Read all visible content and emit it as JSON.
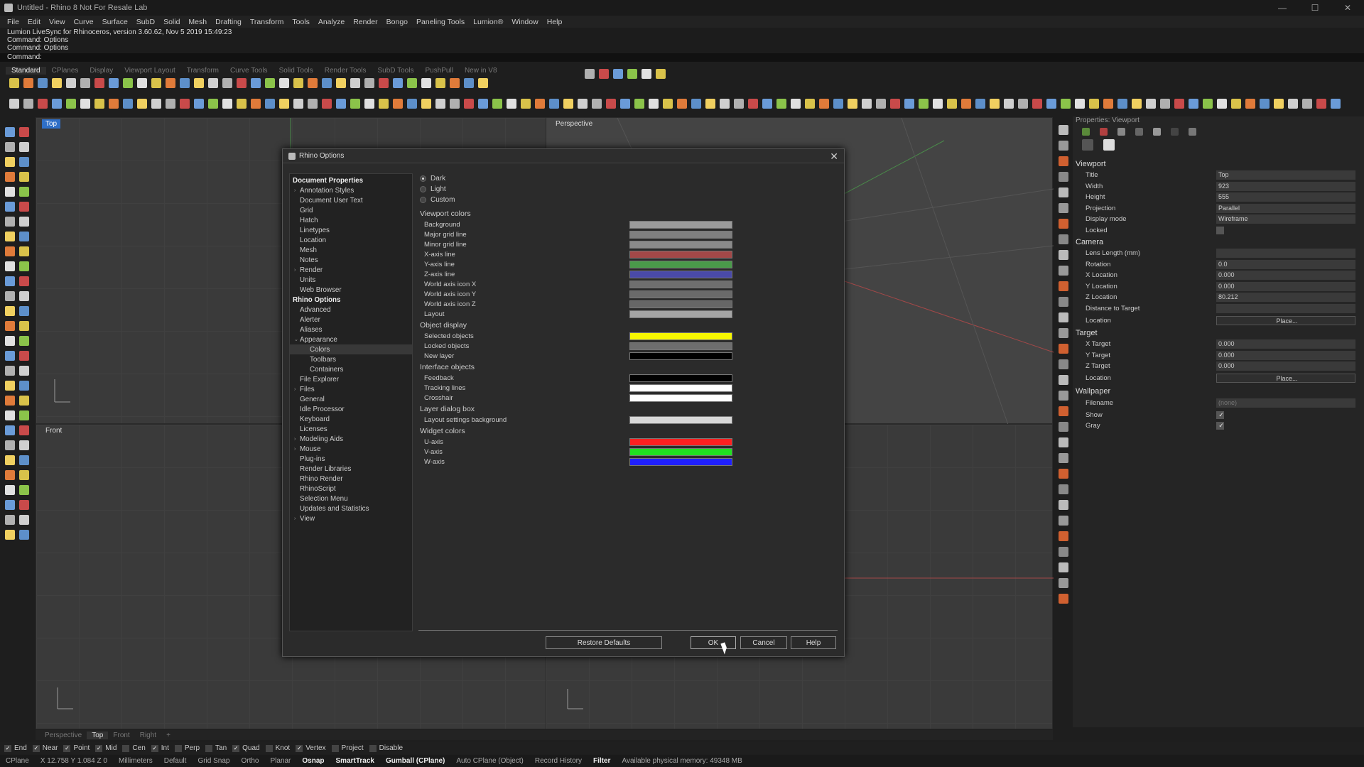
{
  "window": {
    "title": "Untitled - Rhino 8 Not For Resale Lab",
    "minimize": "—",
    "maximize": "☐",
    "close": "✕"
  },
  "menu": [
    "File",
    "Edit",
    "View",
    "Curve",
    "Surface",
    "SubD",
    "Solid",
    "Mesh",
    "Drafting",
    "Transform",
    "Tools",
    "Analyze",
    "Render",
    "Bongo",
    "Paneling Tools",
    "Lumion®",
    "Window",
    "Help"
  ],
  "command_history": [
    "Lumion LiveSync for Rhinoceros, version 3.60.62, Nov 5 2019 15:49:23",
    "Command: Options",
    "Command: Options"
  ],
  "command_prompt": "Command:",
  "toolbar_tabs": [
    "Standard",
    "CPlanes",
    "Display",
    "Viewport Layout",
    "Transform",
    "Curve Tools",
    "Solid Tools",
    "Render Tools",
    "SubD Tools",
    "PushPull",
    "New in V8"
  ],
  "viewports": {
    "top": "Top",
    "perspective": "Perspective",
    "front": "Front",
    "right": "Right"
  },
  "viewport_tabs": [
    "Perspective",
    "Top",
    "Front",
    "Right",
    "+"
  ],
  "properties": {
    "header": "Properties: Viewport",
    "viewport_section": "Viewport",
    "viewport_rows": [
      {
        "label": "Title",
        "value": "Top"
      },
      {
        "label": "Width",
        "value": "923"
      },
      {
        "label": "Height",
        "value": "555"
      },
      {
        "label": "Projection",
        "value": "Parallel"
      },
      {
        "label": "Display mode",
        "value": "Wireframe"
      }
    ],
    "locked_label": "Locked",
    "camera_section": "Camera",
    "camera_rows": [
      {
        "label": "Lens Length (mm)",
        "value": ""
      },
      {
        "label": "Rotation",
        "value": "0.0"
      },
      {
        "label": "X Location",
        "value": "0.000"
      },
      {
        "label": "Y Location",
        "value": "0.000"
      },
      {
        "label": "Z Location",
        "value": "80.212"
      },
      {
        "label": "Distance to Target",
        "value": ""
      }
    ],
    "camera_location_label": "Location",
    "place_button": "Place...",
    "target_section": "Target",
    "target_rows": [
      {
        "label": "X Target",
        "value": "0.000"
      },
      {
        "label": "Y Target",
        "value": "0.000"
      },
      {
        "label": "Z Target",
        "value": "0.000"
      }
    ],
    "target_location_label": "Location",
    "wallpaper_section": "Wallpaper",
    "filename_label": "Filename",
    "filename_value": "(none)",
    "show_label": "Show",
    "gray_label": "Gray",
    "check": "✓"
  },
  "osnaps": [
    {
      "label": "End",
      "checked": true
    },
    {
      "label": "Near",
      "checked": true
    },
    {
      "label": "Point",
      "checked": true
    },
    {
      "label": "Mid",
      "checked": true
    },
    {
      "label": "Cen",
      "checked": false
    },
    {
      "label": "Int",
      "checked": true
    },
    {
      "label": "Perp",
      "checked": false
    },
    {
      "label": "Tan",
      "checked": false
    },
    {
      "label": "Quad",
      "checked": true
    },
    {
      "label": "Knot",
      "checked": false
    },
    {
      "label": "Vertex",
      "checked": true
    },
    {
      "label": "Project",
      "checked": false
    },
    {
      "label": "Disable",
      "checked": false
    }
  ],
  "status": {
    "cplane": "CPlane",
    "coords": "X 12.758 Y 1.084 Z 0",
    "units": "Millimeters",
    "layer": "Default",
    "grid_snap": "Grid Snap",
    "ortho": "Ortho",
    "planar": "Planar",
    "osnap": "Osnap",
    "smarttrack": "SmartTrack",
    "gumball": "Gumball (CPlane)",
    "auto_cplane": "Auto CPlane (Object)",
    "record_history": "Record History",
    "filter": "Filter",
    "memory": "Available physical memory: 49348 MB"
  },
  "dialog": {
    "title": "Rhino Options",
    "close": "✕",
    "tree": [
      {
        "label": "Document Properties",
        "level": 0
      },
      {
        "label": "Annotation Styles",
        "level": 1,
        "arrow": "›"
      },
      {
        "label": "Document User Text",
        "level": 1
      },
      {
        "label": "Grid",
        "level": 1
      },
      {
        "label": "Hatch",
        "level": 1
      },
      {
        "label": "Linetypes",
        "level": 1
      },
      {
        "label": "Location",
        "level": 1
      },
      {
        "label": "Mesh",
        "level": 1
      },
      {
        "label": "Notes",
        "level": 1
      },
      {
        "label": "Render",
        "level": 1,
        "arrow": "›"
      },
      {
        "label": "Units",
        "level": 1
      },
      {
        "label": "Web Browser",
        "level": 1
      },
      {
        "label": "Rhino Options",
        "level": 0
      },
      {
        "label": "Advanced",
        "level": 1
      },
      {
        "label": "Alerter",
        "level": 1
      },
      {
        "label": "Aliases",
        "level": 1
      },
      {
        "label": "Appearance",
        "level": 1,
        "arrow": "⌄"
      },
      {
        "label": "Colors",
        "level": 2,
        "selected": true
      },
      {
        "label": "Toolbars",
        "level": 2
      },
      {
        "label": "Containers",
        "level": 2
      },
      {
        "label": "File Explorer",
        "level": 1
      },
      {
        "label": "Files",
        "level": 1,
        "arrow": "›"
      },
      {
        "label": "General",
        "level": 1
      },
      {
        "label": "Idle Processor",
        "level": 1
      },
      {
        "label": "Keyboard",
        "level": 1
      },
      {
        "label": "Licenses",
        "level": 1
      },
      {
        "label": "Modeling Aids",
        "level": 1,
        "arrow": "›"
      },
      {
        "label": "Mouse",
        "level": 1,
        "arrow": "›"
      },
      {
        "label": "Plug-ins",
        "level": 1
      },
      {
        "label": "Render Libraries",
        "level": 1
      },
      {
        "label": "Rhino Render",
        "level": 1
      },
      {
        "label": "RhinoScript",
        "level": 1
      },
      {
        "label": "Selection Menu",
        "level": 1
      },
      {
        "label": "Updates and Statistics",
        "level": 1
      },
      {
        "label": "View",
        "level": 1,
        "arrow": "›"
      }
    ],
    "themes": [
      {
        "label": "Dark",
        "selected": true
      },
      {
        "label": "Light",
        "selected": false
      },
      {
        "label": "Custom",
        "selected": false
      }
    ],
    "groups": [
      {
        "heading": "Viewport colors",
        "rows": [
          {
            "label": "Background",
            "color": "#9a9a9a"
          },
          {
            "label": "Major grid line",
            "color": "#7f7f7f"
          },
          {
            "label": "Minor grid line",
            "color": "#8a8a8a"
          },
          {
            "label": "X-axis line",
            "color": "#a24848"
          },
          {
            "label": "Y-axis line",
            "color": "#4a9a4a"
          },
          {
            "label": "Z-axis line",
            "color": "#4a4aa8"
          },
          {
            "label": "World axis icon X",
            "color": "#6f6f6f"
          },
          {
            "label": "World axis icon Y",
            "color": "#6a6a6a"
          },
          {
            "label": "World axis icon Z",
            "color": "#666666"
          },
          {
            "label": "Layout",
            "color": "#a5a5a5"
          }
        ]
      },
      {
        "heading": "Object display",
        "rows": [
          {
            "label": "Selected objects",
            "color": "#f5f500"
          },
          {
            "label": "Locked objects",
            "color": "#6e6e6e"
          },
          {
            "label": "New layer",
            "color": "#000000"
          }
        ]
      },
      {
        "heading": "Interface objects",
        "rows": [
          {
            "label": "Feedback",
            "color": "#000000"
          },
          {
            "label": "Tracking lines",
            "color": "#ffffff"
          },
          {
            "label": "Crosshair",
            "color": "#ffffff"
          }
        ]
      },
      {
        "heading": "Layer dialog box",
        "rows": [
          {
            "label": "Layout settings background",
            "color": "#d8d8d8"
          }
        ]
      },
      {
        "heading": "Widget colors",
        "rows": [
          {
            "label": "U-axis",
            "color": "#ff2020"
          },
          {
            "label": "V-axis",
            "color": "#20e020"
          },
          {
            "label": "W-axis",
            "color": "#2020ff"
          }
        ]
      }
    ],
    "buttons": {
      "restore": "Restore Defaults",
      "ok": "OK",
      "cancel": "Cancel",
      "help": "Help"
    }
  }
}
